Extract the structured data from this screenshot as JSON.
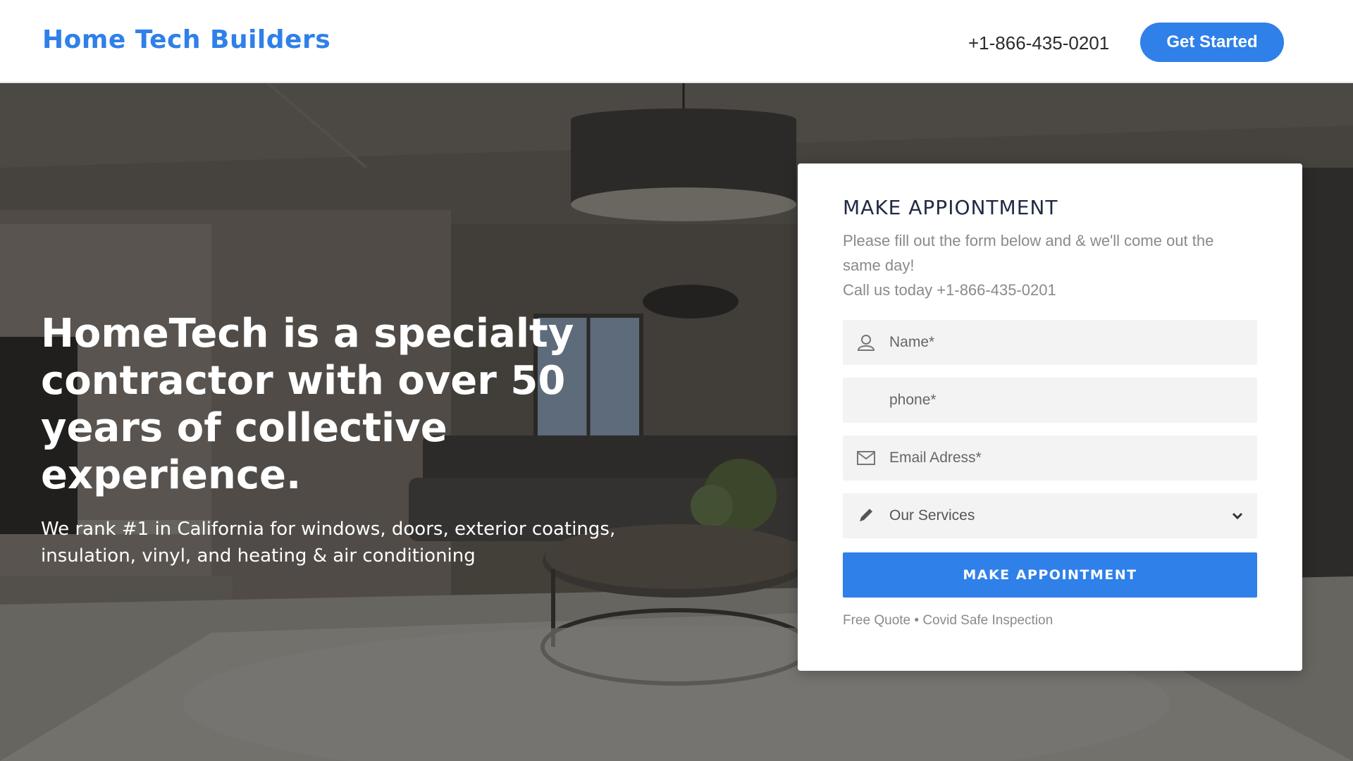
{
  "header": {
    "brand": "Home Tech Builders",
    "phone": "+1-866-435-0201",
    "cta_label": "Get Started"
  },
  "hero": {
    "title": "HomeTech is a specialty contractor with over 50 years of collective experience.",
    "subtitle": "We rank #1 in California for windows, doors, exterior coatings, insulation, vinyl, and heating & air conditioning"
  },
  "form": {
    "title": "MAKE APPIONTMENT",
    "desc_line1": "Please fill out the form below and & we'll come out the same day!",
    "desc_line2": "Call us today +1-866-435-0201",
    "name_placeholder": "Name*",
    "phone_placeholder": "phone*",
    "email_placeholder": "Email Adress*",
    "services_selected": "Our Services",
    "submit_label": "MAKE APPOINTMENT",
    "note": "Free Quote • Covid Safe Inspection"
  },
  "colors": {
    "accent": "#2f80e9",
    "title_dark": "#1f2a44",
    "muted": "#8a8a8a"
  },
  "icons": {
    "name_field": "user-icon",
    "email_field": "envelope-icon",
    "services_field": "pencil-icon",
    "select_arrow": "chevron-down-icon"
  }
}
